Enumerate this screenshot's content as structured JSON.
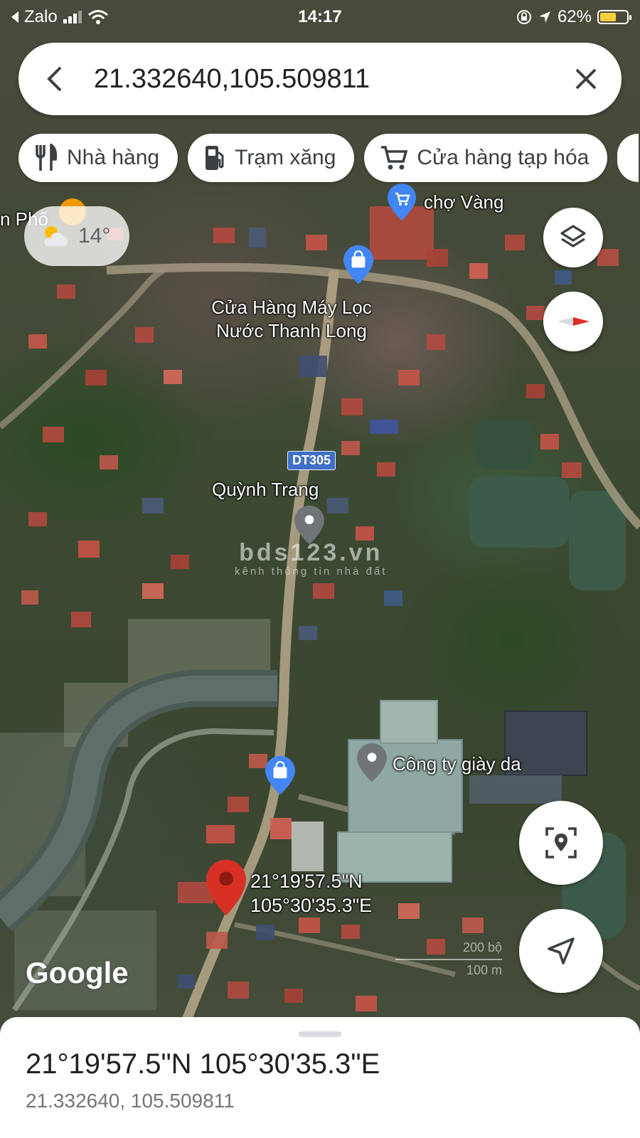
{
  "status_bar": {
    "back_app": "Zalo",
    "time": "14:17",
    "battery": "62%",
    "battery_level": 0.62
  },
  "search": {
    "query": "21.332640,105.509811"
  },
  "chips": [
    {
      "icon": "fork-knife-icon",
      "label": "Nhà hàng"
    },
    {
      "icon": "gas-pump-icon",
      "label": "Trạm xăng"
    },
    {
      "icon": "shopping-cart-icon",
      "label": "Cửa hàng tạp hóa"
    }
  ],
  "weather": {
    "temperature": "14°",
    "icon": "partly-cloudy-icon"
  },
  "map_labels": {
    "partial_place": "n Phố",
    "market": "chợ Vàng",
    "shop1_line1": "Cửa Hàng Máy Lọc",
    "shop1_line2": "Nước Thanh Long",
    "route": "DT305",
    "place2": "Quỳnh Trang",
    "company": "Công ty giày da",
    "pin_lat": "21°19'57.5\"N",
    "pin_lon": "105°30'35.3\"E"
  },
  "watermark": {
    "main": "bds123.vn",
    "sub": "kênh thông tin nhà đất"
  },
  "branding": {
    "logo": "Google"
  },
  "scale": {
    "feet": "200 bộ",
    "meters": "100 m"
  },
  "bottom_sheet": {
    "title": "21°19'57.5\"N 105°30'35.3\"E",
    "coordinates": "21.332640, 105.509811"
  },
  "colors": {
    "pin_red": "#d93025",
    "poi_blue": "#4285f4",
    "poi_gray": "#70757a",
    "route_blue": "#3f6fc7"
  }
}
